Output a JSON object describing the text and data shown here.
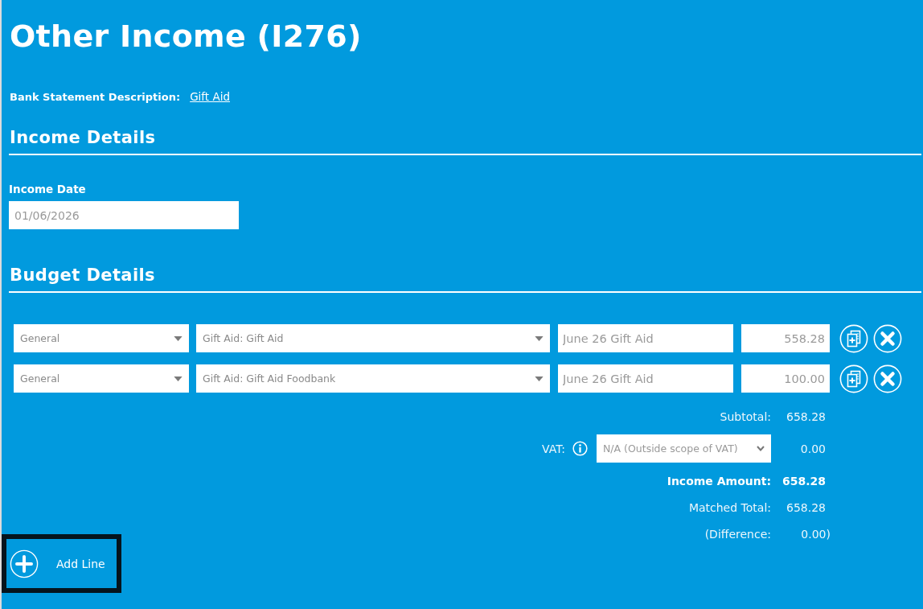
{
  "page": {
    "title": "Other Income (I276)"
  },
  "bank_statement": {
    "label": "Bank Statement Description:",
    "link": "Gift Aid"
  },
  "income_details": {
    "heading": "Income Details",
    "date_label": "Income Date",
    "date_value": "01/06/2026"
  },
  "budget_details": {
    "heading": "Budget Details",
    "lines": [
      {
        "fund": "General",
        "budget": "Gift Aid: Gift Aid",
        "description": "June 26 Gift Aid",
        "amount": "558.28"
      },
      {
        "fund": "General",
        "budget": "Gift Aid: Gift Aid Foodbank",
        "description": "June 26 Gift Aid",
        "amount": "100.00"
      }
    ]
  },
  "totals": [
    {
      "kind": "plain",
      "label": "Subtotal:",
      "value": "658.28"
    },
    {
      "kind": "vat",
      "label": "VAT:",
      "option": "N/A (Outside scope of VAT)",
      "value": "0.00"
    },
    {
      "kind": "bold",
      "label": "Income Amount:",
      "value": "658.28"
    },
    {
      "kind": "plain",
      "label": "Matched Total:",
      "value": "658.28"
    },
    {
      "kind": "difference",
      "label": "(Difference:",
      "value": "0.00)"
    }
  ],
  "add_line": {
    "label": "Add Line",
    "focused": true
  }
}
